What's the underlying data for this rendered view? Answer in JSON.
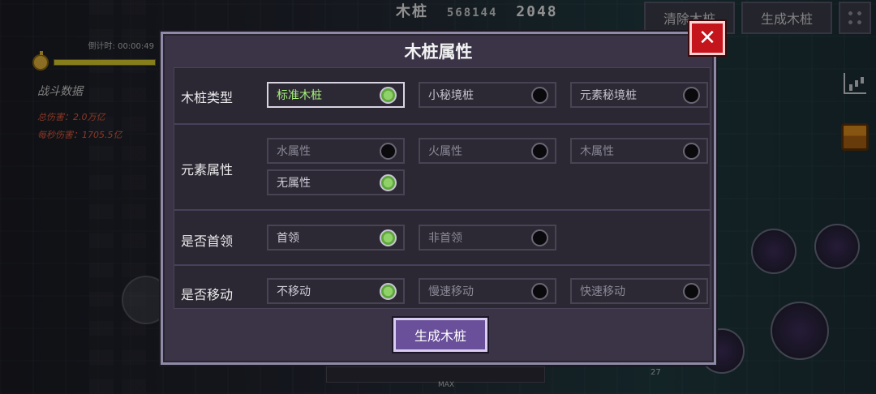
{
  "hud": {
    "top_text_a": "木桩",
    "top_text_b": "568144",
    "top_text_c": "2048",
    "timer_label": "倒计时: 00:00:49",
    "stats_title": "战斗数据",
    "total_damage": "总伤害：2.0万亿",
    "dps": "每秒伤害：1705.5亿",
    "clear_button": "清除木桩",
    "generate_top_button": "生成木桩",
    "bottom_max": "MAX",
    "bottom_num": "27",
    "icons": [
      "stopwatch-icon",
      "grid-icon",
      "chart-icon",
      "chest-icon"
    ]
  },
  "dialog": {
    "title": "木桩属性",
    "close_label": "✕",
    "generate_label": "生成木桩",
    "sections": [
      {
        "label": "木桩类型",
        "options": [
          {
            "label": "标准木桩",
            "selected": true
          },
          {
            "label": "小秘境桩",
            "selected": false
          },
          {
            "label": "元素秘境桩",
            "selected": false
          }
        ]
      },
      {
        "label": "元素属性",
        "options": [
          {
            "label": "水属性",
            "selected": false
          },
          {
            "label": "火属性",
            "selected": false
          },
          {
            "label": "木属性",
            "selected": false
          },
          {
            "label": "无属性",
            "selected": true
          }
        ]
      },
      {
        "label": "是否首领",
        "options": [
          {
            "label": "首领",
            "selected": true
          },
          {
            "label": "非首领",
            "selected": false
          }
        ]
      },
      {
        "label": "是否移动",
        "options": [
          {
            "label": "不移动",
            "selected": true
          },
          {
            "label": "慢速移动",
            "selected": false
          },
          {
            "label": "快速移动",
            "selected": false
          }
        ]
      }
    ]
  },
  "colors": {
    "selected_green": "#8fd267",
    "close_red": "#c4141c",
    "generate_purple": "#6a4f9a"
  }
}
